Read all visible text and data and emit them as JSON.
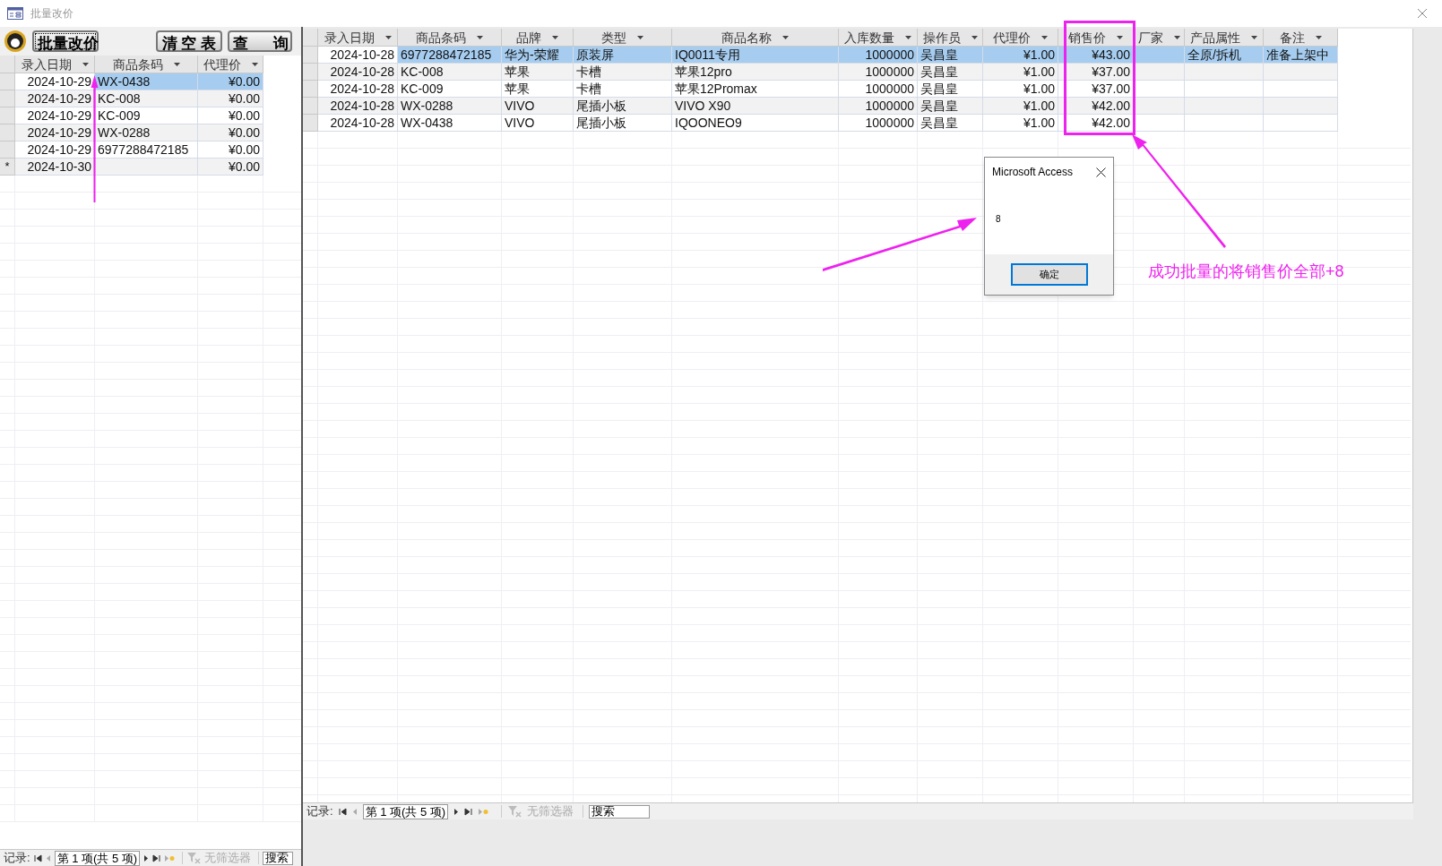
{
  "window": {
    "title": "批量改价"
  },
  "left_form": {
    "buttons": [
      {
        "label": "批量改价",
        "focused": true
      },
      {
        "label": "清 空 表",
        "focused": false
      },
      {
        "label": "查      询",
        "focused": false
      }
    ],
    "table": {
      "columns": [
        {
          "label": "录入日期",
          "numeric": true
        },
        {
          "label": "商品条码",
          "numeric": false
        },
        {
          "label": "代理价",
          "numeric": true
        }
      ],
      "rows": [
        {
          "cells": [
            "2024-10-29",
            "WX-0438",
            "¥0.00"
          ],
          "selected": true
        },
        {
          "cells": [
            "2024-10-29",
            "KC-008",
            "¥0.00"
          ],
          "selected": false
        },
        {
          "cells": [
            "2024-10-29",
            "KC-009",
            "¥0.00"
          ],
          "selected": false
        },
        {
          "cells": [
            "2024-10-29",
            "WX-0288",
            "¥0.00"
          ],
          "selected": false
        },
        {
          "cells": [
            "2024-10-29",
            "6977288472185",
            "¥0.00"
          ],
          "selected": false
        },
        {
          "cells": [
            "2024-10-30",
            "",
            "¥0.00"
          ],
          "selected": false,
          "marker": "*"
        }
      ]
    },
    "nav": {
      "label": "记录:",
      "position": "第 1 项(共 5 项)",
      "filter": "无筛选器",
      "search_placeholder": "搜索"
    }
  },
  "right_form": {
    "table": {
      "columns": [
        {
          "label": "录入日期",
          "numeric": true
        },
        {
          "label": "商品条码",
          "numeric": false
        },
        {
          "label": "品牌",
          "numeric": false
        },
        {
          "label": "类型",
          "numeric": false
        },
        {
          "label": "商品名称",
          "numeric": false
        },
        {
          "label": "入库数量",
          "numeric": true
        },
        {
          "label": "操作员",
          "numeric": false
        },
        {
          "label": "代理价",
          "numeric": true
        },
        {
          "label": "销售价",
          "numeric": true
        },
        {
          "label": "厂家",
          "numeric": false
        },
        {
          "label": "产品属性",
          "numeric": false
        },
        {
          "label": "备注",
          "numeric": false
        }
      ],
      "rows": [
        {
          "cells": [
            "2024-10-28",
            "6977288472185",
            "华为-荣耀",
            "原装屏",
            "IQ0011专用",
            "1000000",
            "吴昌皇",
            "¥1.00",
            "¥43.00",
            "",
            "全原/拆机",
            "准备上架中"
          ],
          "selected": true
        },
        {
          "cells": [
            "2024-10-28",
            "KC-008",
            "苹果",
            "卡槽",
            "苹果12pro",
            "1000000",
            "吴昌皇",
            "¥1.00",
            "¥37.00",
            "",
            "",
            ""
          ],
          "selected": false
        },
        {
          "cells": [
            "2024-10-28",
            "KC-009",
            "苹果",
            "卡槽",
            "苹果12Promax",
            "1000000",
            "吴昌皇",
            "¥1.00",
            "¥37.00",
            "",
            "",
            ""
          ],
          "selected": false
        },
        {
          "cells": [
            "2024-10-28",
            "WX-0288",
            "VIVO",
            "尾插小板",
            "VIVO X90",
            "1000000",
            "吴昌皇",
            "¥1.00",
            "¥42.00",
            "",
            "",
            ""
          ],
          "selected": false
        },
        {
          "cells": [
            "2024-10-28",
            "WX-0438",
            "VIVO",
            "尾插小板",
            "IQOONEO9",
            "1000000",
            "吴昌皇",
            "¥1.00",
            "¥42.00",
            "",
            "",
            ""
          ],
          "selected": false
        }
      ]
    },
    "nav": {
      "label": "记录:",
      "position": "第 1 项(共 5 项)",
      "filter": "无筛选器",
      "search_placeholder": "搜索"
    }
  },
  "dialog": {
    "title": "Microsoft Access",
    "message": "8",
    "button": "确定"
  },
  "annotation": {
    "text": "成功批量的将销售价全部+8"
  }
}
